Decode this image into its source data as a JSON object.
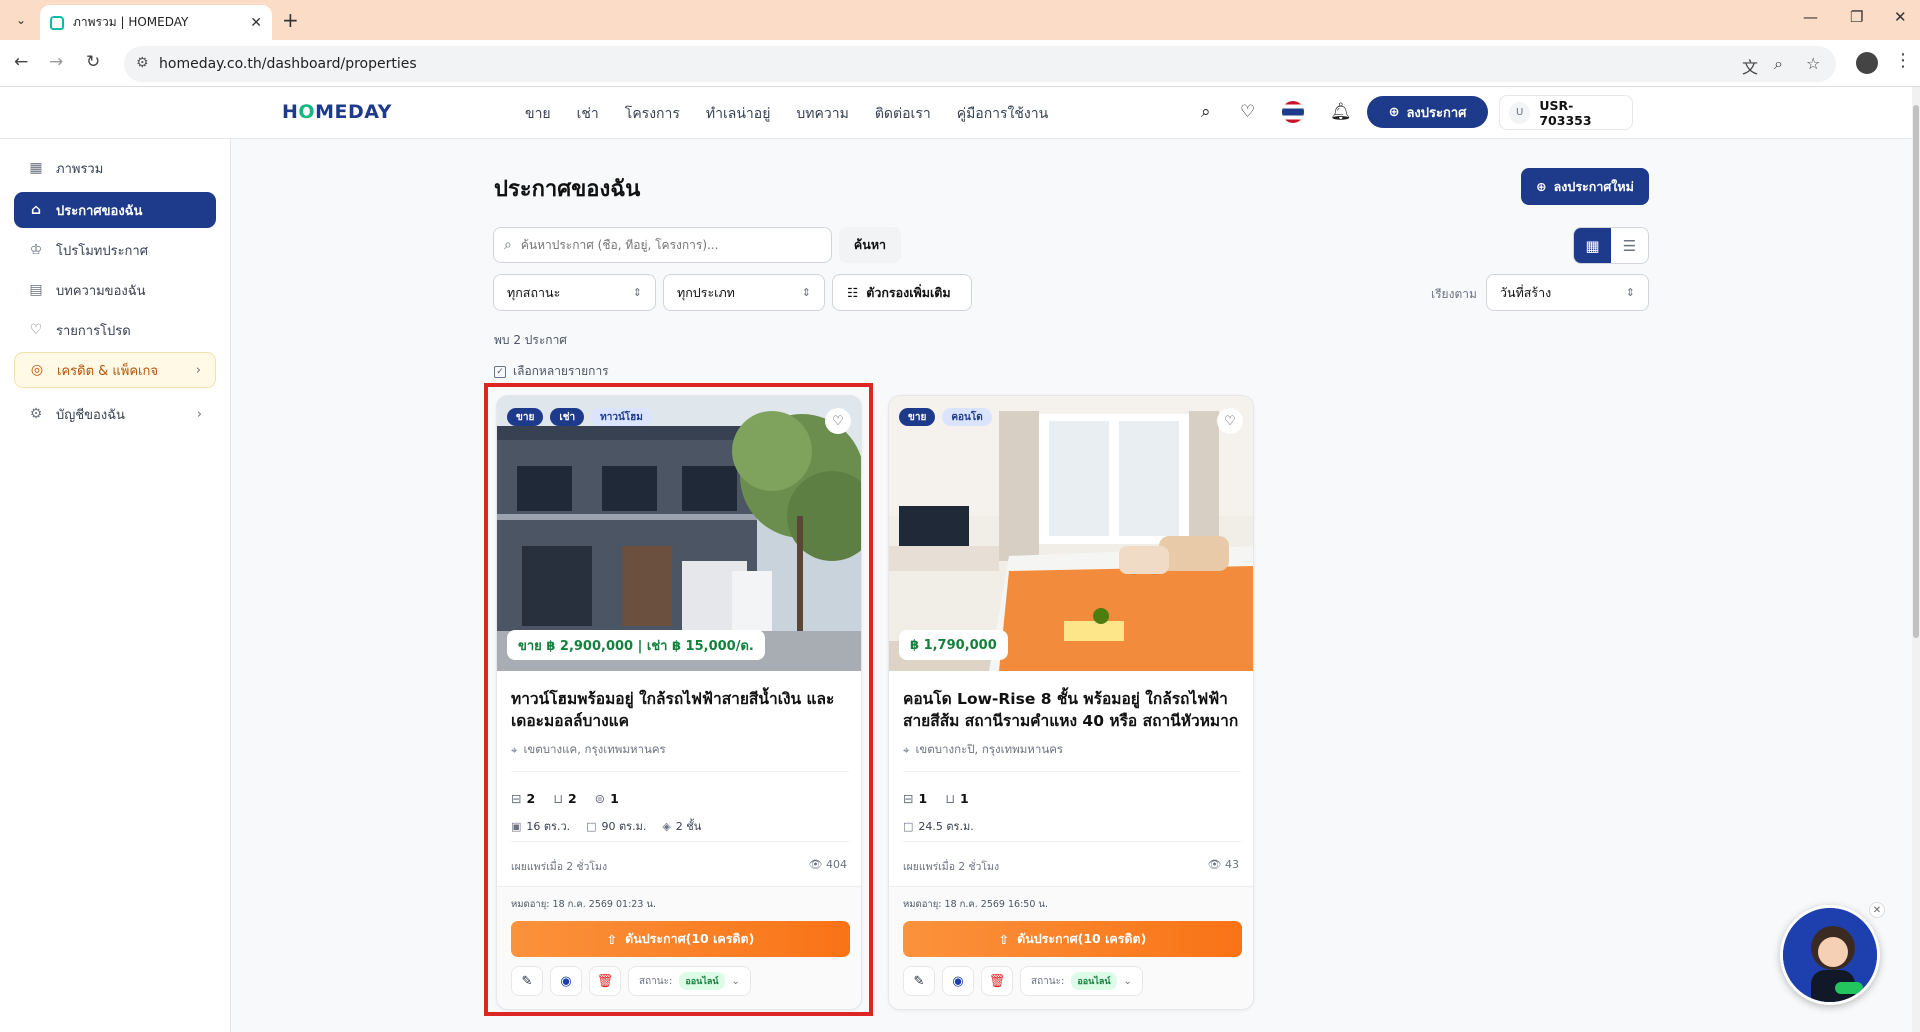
{
  "browser": {
    "tab_title": "ภาพรวม | HOMEDAY",
    "url": "homeday.co.th/dashboard/properties"
  },
  "header": {
    "logo_a": "H",
    "logo_o": "O",
    "logo_b": "MEDAY",
    "nav": [
      "ขาย",
      "เช่า",
      "โครงการ",
      "ทำเลน่าอยู่",
      "บทความ",
      "ติดต่อเรา",
      "คู่มือการใช้งาน"
    ],
    "post_button": "ลงประกาศ",
    "user_initial": "U",
    "user_id": "USR-703353"
  },
  "sidebar": {
    "items": [
      {
        "label": "ภาพรวม",
        "icon": "grid-icon"
      },
      {
        "label": "ประกาศของฉัน",
        "icon": "home-icon"
      },
      {
        "label": "โปรโมทประกาศ",
        "icon": "crown-icon"
      },
      {
        "label": "บทความของฉัน",
        "icon": "document-icon"
      },
      {
        "label": "รายการโปรด",
        "icon": "heart-icon"
      },
      {
        "label": "เครดิต & แพ็คเกจ",
        "icon": "coins-icon"
      },
      {
        "label": "บัญชีของฉัน",
        "icon": "gear-icon"
      }
    ]
  },
  "main": {
    "title": "ประกาศของฉัน",
    "new_post_button": "ลงประกาศใหม่",
    "search_placeholder": "ค้นหาประกาศ (ชื่อ, ที่อยู่, โครงการ)...",
    "search_button": "ค้นหา",
    "status_filter": "ทุกสถานะ",
    "type_filter": "ทุกประเภท",
    "more_filters": "ตัวกรองเพิ่มเติม",
    "sort_label": "เรียงตาม",
    "sort_value": "วันที่สร้าง",
    "found_text": "พบ 2 ประกาศ",
    "multi_select": "เลือกหลายรายการ"
  },
  "cards": [
    {
      "tags": [
        "ขาย",
        "เช่า",
        "ทาวน์โฮม"
      ],
      "price": "ขาย ฿ 2,900,000 | เช่า ฿ 15,000/ด.",
      "title": "ทาวน์โฮมพร้อมอยู่ ใกล้รถไฟฟ้าสายสีน้ำเงิน และเดอะมอลล์บางแค",
      "location": "เขตบางแค, กรุงเทพมหานคร",
      "beds": "2",
      "baths": "2",
      "parking": "1",
      "land": "16 ตร.ว.",
      "area": "90 ตร.ม.",
      "floors": "2 ชั้น",
      "published": "เผยแพร่เมื่อ 2 ชั่วโมง",
      "views": "404",
      "expires": "หมดอายุ: 18 ก.ค. 2569 01:23 น.",
      "boost": "ดันประกาศ(10 เครดิต)",
      "status_label": "สถานะ:",
      "status": "ออนไลน์"
    },
    {
      "tags": [
        "ขาย",
        "คอนโด"
      ],
      "price": "฿ 1,790,000",
      "title": "คอนโด Low-Rise 8 ชั้น พร้อมอยู่ ใกล้รถไฟฟ้าสายสีส้ม สถานีรามคำแหง 40 หรือ สถานีหัวหมาก",
      "location": "เขตบางกะปิ, กรุงเทพมหานคร",
      "beds": "1",
      "baths": "1",
      "area": "24.5 ตร.ม.",
      "published": "เผยแพร่เมื่อ 2 ชั่วโมง",
      "views": "43",
      "expires": "หมดอายุ: 18 ก.ค. 2569 16:50 น.",
      "boost": "ดันประกาศ(10 เครดิต)",
      "status_label": "สถานะ:",
      "status": "ออนไลน์"
    }
  ],
  "colors": {
    "brand": "#1e3a8a",
    "accent_green": "#10b981",
    "boost_orange": "#f97316",
    "highlight": "#dc2626"
  }
}
